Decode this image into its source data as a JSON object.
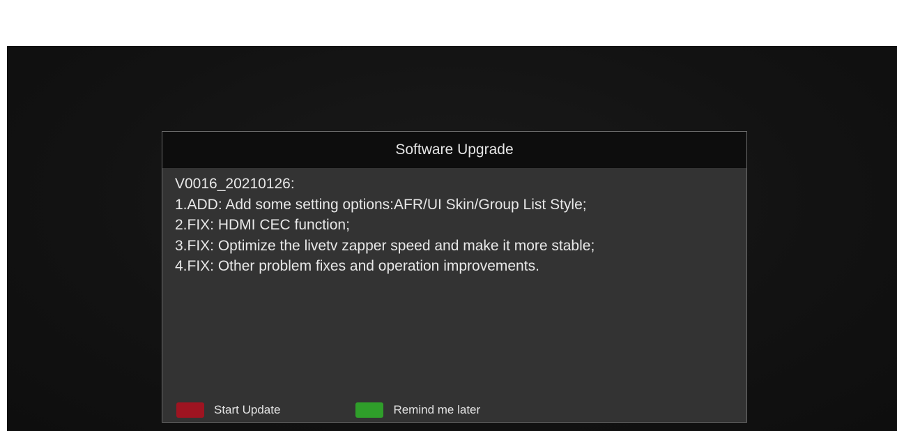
{
  "dialog": {
    "title": "Software Upgrade",
    "notes": [
      "V0016_20210126:",
      "1.ADD: Add some setting options:AFR/UI Skin/Group List Style;",
      "2.FIX: HDMI CEC function;",
      "3.FIX: Optimize the livetv zapper speed and make it more stable;",
      "4.FIX: Other problem fixes and operation improvements."
    ]
  },
  "footer": {
    "actions": [
      {
        "label": "Start Update",
        "key_color": "#9e1421",
        "key_name": "red-key"
      },
      {
        "label": "Remind me later",
        "key_color": "#2f9e2a",
        "key_name": "green-key"
      }
    ]
  }
}
